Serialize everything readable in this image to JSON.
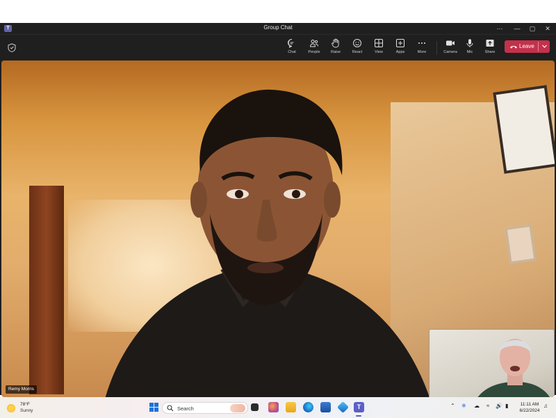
{
  "window": {
    "title": "Group Chat",
    "controls": {
      "more": "⋯",
      "minimize": "—",
      "maximize": "▢",
      "close": "✕"
    }
  },
  "toolbar": {
    "buttons": [
      {
        "label": "Chat",
        "icon": "chat-icon"
      },
      {
        "label": "People",
        "icon": "people-icon"
      },
      {
        "label": "Raise",
        "icon": "raise-hand-icon"
      },
      {
        "label": "React",
        "icon": "react-icon"
      },
      {
        "label": "View",
        "icon": "view-icon"
      },
      {
        "label": "Apps",
        "icon": "apps-icon"
      },
      {
        "label": "More",
        "icon": "more-icon"
      },
      {
        "label": "Camera",
        "icon": "camera-icon"
      },
      {
        "label": "Mic",
        "icon": "mic-icon"
      },
      {
        "label": "Share",
        "icon": "share-icon"
      }
    ],
    "leave_label": "Leave",
    "leave_color": "#c4314b"
  },
  "participant": {
    "name": "Remy Morris"
  },
  "taskbar": {
    "weather": {
      "temp": "78°F",
      "condition": "Sunny"
    },
    "search_placeholder": "Search",
    "clock": {
      "time": "11:11 AM",
      "date": "6/22/2024"
    },
    "accent": "#5b5fc7"
  }
}
